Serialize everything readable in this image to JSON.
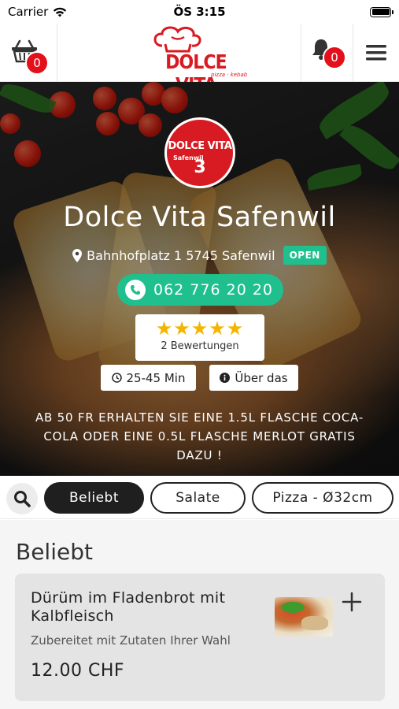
{
  "status_bar": {
    "carrier": "Carrier",
    "time": "ÖS 3:15"
  },
  "header": {
    "cart_count": "0",
    "notification_count": "0",
    "logo": {
      "brand": "DOLCE VITA",
      "tagline": "pizza · kebab"
    }
  },
  "hero": {
    "logo": {
      "brand": "DOLCE VITA",
      "sub": "Safenwil",
      "number": "3"
    },
    "title": "Dolce Vita Safenwil",
    "address": "Bahnhofplatz 1 5745 Safenwil",
    "open_status": "OPEN",
    "phone": "062 776 20 20",
    "rating": {
      "stars": 5,
      "stars_text": "★★★★★",
      "reviews": "2 Bewertungen"
    },
    "delivery_time": "25-45 Min",
    "about_label": "Über das",
    "promo": "AB 50 FR ERHALTEN SIE EINE 1.5L FLASCHE COCA-COLA ODER EINE 0.5L FLASCHE MERLOT GRATIS DAZU !"
  },
  "tabs": [
    {
      "label": "Beliebt",
      "active": true
    },
    {
      "label": "Salate",
      "active": false
    },
    {
      "label": "Pizza - Ø32cm",
      "active": false
    }
  ],
  "section": {
    "title": "Beliebt",
    "items": [
      {
        "name": "Dürüm im Fladenbrot mit Kalbfleisch",
        "description": "Zubereitet mit Zutaten Ihrer Wahl",
        "price": "12.00 CHF"
      }
    ]
  },
  "colors": {
    "brand_red": "#d81b22",
    "accent_green": "#1fc08e",
    "star": "#f5b400"
  }
}
